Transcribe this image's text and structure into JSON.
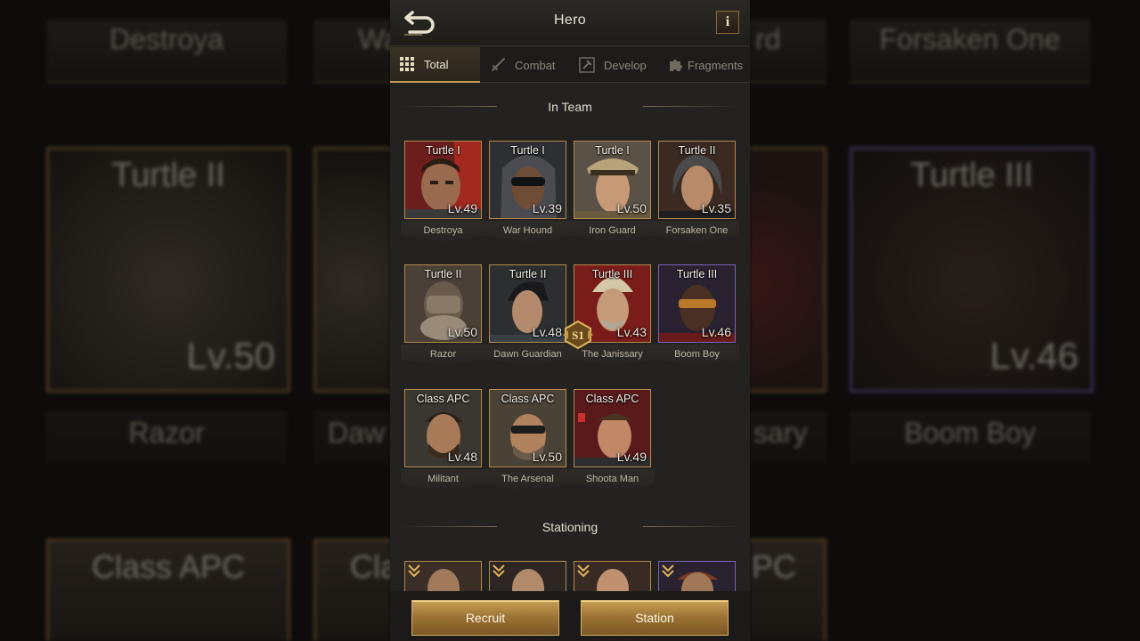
{
  "header": {
    "title": "Hero",
    "info_label": "i"
  },
  "tabs": [
    {
      "label": "Total",
      "icon": "grid-icon",
      "active": true
    },
    {
      "label": "Combat",
      "icon": "sword-icon",
      "active": false
    },
    {
      "label": "Develop",
      "icon": "hammer-icon",
      "active": false
    },
    {
      "label": "Fragments",
      "icon": "puzzle-icon",
      "active": false
    }
  ],
  "sections": {
    "team": "In Team",
    "stationing": "Stationing"
  },
  "heroes": [
    {
      "rank": "Turtle I",
      "level": "Lv.49",
      "name": "Destroya",
      "frame": "gold"
    },
    {
      "rank": "Turtle I",
      "level": "Lv.39",
      "name": "War Hound",
      "frame": "gold"
    },
    {
      "rank": "Turtle I",
      "level": "Lv.50",
      "name": "Iron Guard",
      "frame": "gold"
    },
    {
      "rank": "Turtle II",
      "level": "Lv.35",
      "name": "Forsaken One",
      "frame": "gold"
    },
    {
      "rank": "Turtle II",
      "level": "Lv.50",
      "name": "Razor",
      "frame": "gold"
    },
    {
      "rank": "Turtle II",
      "level": "Lv.48",
      "name": "Dawn Guardian",
      "frame": "gold"
    },
    {
      "rank": "Turtle III",
      "level": "Lv.43",
      "name": "The Janissary",
      "frame": "gold",
      "badge": "S1"
    },
    {
      "rank": "Turtle III",
      "level": "Lv.46",
      "name": "Boom Boy",
      "frame": "purple"
    },
    {
      "rank": "Class APC",
      "level": "Lv.48",
      "name": "Militant",
      "frame": "gold"
    },
    {
      "rank": "Class APC",
      "level": "Lv.50",
      "name": "The Arsenal",
      "frame": "gold"
    },
    {
      "rank": "Class APC",
      "level": "Lv.49",
      "name": "Shoota Man",
      "frame": "gold"
    }
  ],
  "background": {
    "top_labels": [
      "Destroya",
      "Wa",
      "rd",
      "Forsaken One"
    ],
    "cards": [
      {
        "rank": "Turtle II",
        "level": "Lv.50"
      },
      {
        "rank": "Turtle III",
        "level": "Lv.46"
      }
    ],
    "bottom_labels": [
      "Razor",
      "Daw",
      "sary",
      "Boom Boy"
    ],
    "bottom_cards": [
      "Class APC",
      "Cla",
      "PC"
    ]
  },
  "footer": {
    "recruit_label": "Recruit",
    "station_label": "Station"
  },
  "colors": {
    "accent_gold": "#c9a057",
    "frame_gold": "#b48a4c",
    "frame_purple": "#7b64b8",
    "panel_bg": "#232220"
  }
}
